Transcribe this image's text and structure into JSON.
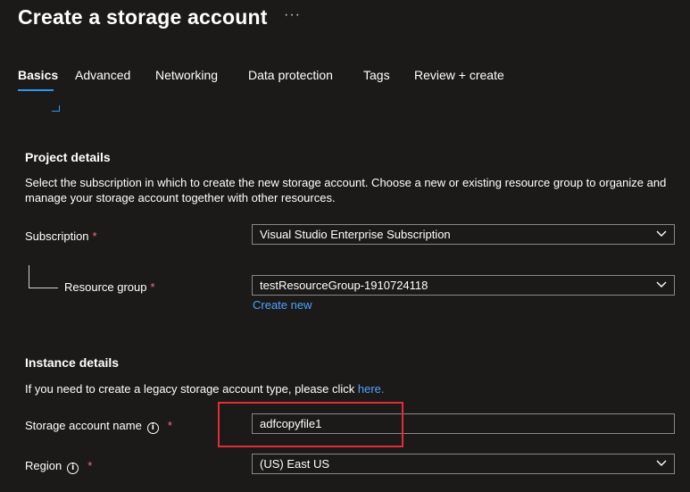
{
  "header": {
    "title": "Create a storage account",
    "more_icon": "ellipsis-icon",
    "more_glyph": "···"
  },
  "tabs": [
    {
      "label": "Basics",
      "active": true
    },
    {
      "label": "Advanced"
    },
    {
      "label": "Networking"
    },
    {
      "label": "Data protection"
    },
    {
      "label": "Tags"
    },
    {
      "label": "Review + create"
    }
  ],
  "project": {
    "title": "Project details",
    "description": "Select the subscription in which to create the new storage account. Choose a new or existing resource group to organize and manage your storage account together with other resources.",
    "subscription": {
      "label": "Subscription",
      "required": "*",
      "value": "Visual Studio Enterprise Subscription"
    },
    "resource_group": {
      "label": "Resource group",
      "required": "*",
      "value": "testResourceGroup-1910724118",
      "create_new": "Create new"
    }
  },
  "instance": {
    "title": "Instance details",
    "description": "If you need to create a legacy storage account type, please click ",
    "description_link": "here.",
    "storage_name": {
      "label": "Storage account name",
      "info_glyph": "i",
      "required": "*",
      "value": "adfcopyfile1"
    },
    "region": {
      "label": "Region",
      "info_glyph": "i",
      "required": "*",
      "value": "(US) East US"
    }
  },
  "colors": {
    "background": "#1b1a19",
    "accent": "#2899f5",
    "link": "#4da3ff",
    "required": "#f1707b",
    "highlight": "#e22d35"
  }
}
